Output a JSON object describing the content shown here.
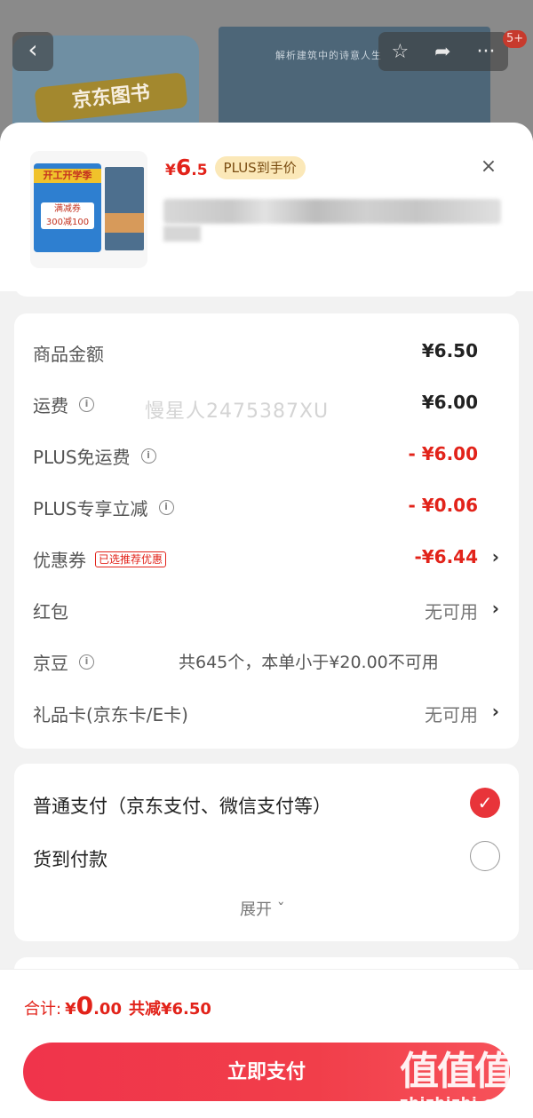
{
  "background": {
    "banner_text": "京东图书",
    "book_tagline": "解析建筑中的诗意人生"
  },
  "status": {
    "badge": "5+"
  },
  "product": {
    "thumb_card_title": "开工开学季",
    "thumb_card_line1": "满减券",
    "thumb_card_line2": "300减100",
    "price_symbol": "¥",
    "price_int": "6",
    "price_dec": ".5",
    "plus_tag": "PLUS到手价",
    "close": "×"
  },
  "fees": {
    "rows": [
      {
        "label": "商品金额",
        "value": "¥6.50"
      },
      {
        "label": "运费",
        "value": "¥6.00"
      },
      {
        "label": "PLUS免运费",
        "value": "- ¥6.00"
      },
      {
        "label": "PLUS专享立减",
        "value": "- ¥0.06"
      },
      {
        "label": "优惠券",
        "tag": "已选推荐优惠",
        "value": "-¥6.44"
      },
      {
        "label": "红包",
        "value": "无可用"
      },
      {
        "label": "京豆",
        "note": "共645个，本单小于¥20.00不可用"
      },
      {
        "label": "礼品卡(京东卡/E卡)",
        "value": "无可用"
      }
    ],
    "info_glyph": "i",
    "chevron": "›"
  },
  "watermark": "慢星人2475387XU",
  "payment": {
    "options": [
      {
        "label": "普通支付（京东支付、微信支付等）",
        "selected": true
      },
      {
        "label": "货到付款",
        "selected": false
      }
    ],
    "checkmark": "✓",
    "expand": "展开 ˇ"
  },
  "bottom": {
    "total_label": "合计:",
    "total_symbol": "¥",
    "total_int": "0",
    "total_dec": ".00",
    "total_reduce": "共减¥6.50",
    "pay_button": "立即支付"
  },
  "brand": {
    "mark": "值值值",
    "url": "zhizhizhi.com"
  },
  "colors": {
    "accent_red": "#e2231a",
    "button_red": "#f0344b",
    "plus_gold": "#fbe8b8"
  }
}
